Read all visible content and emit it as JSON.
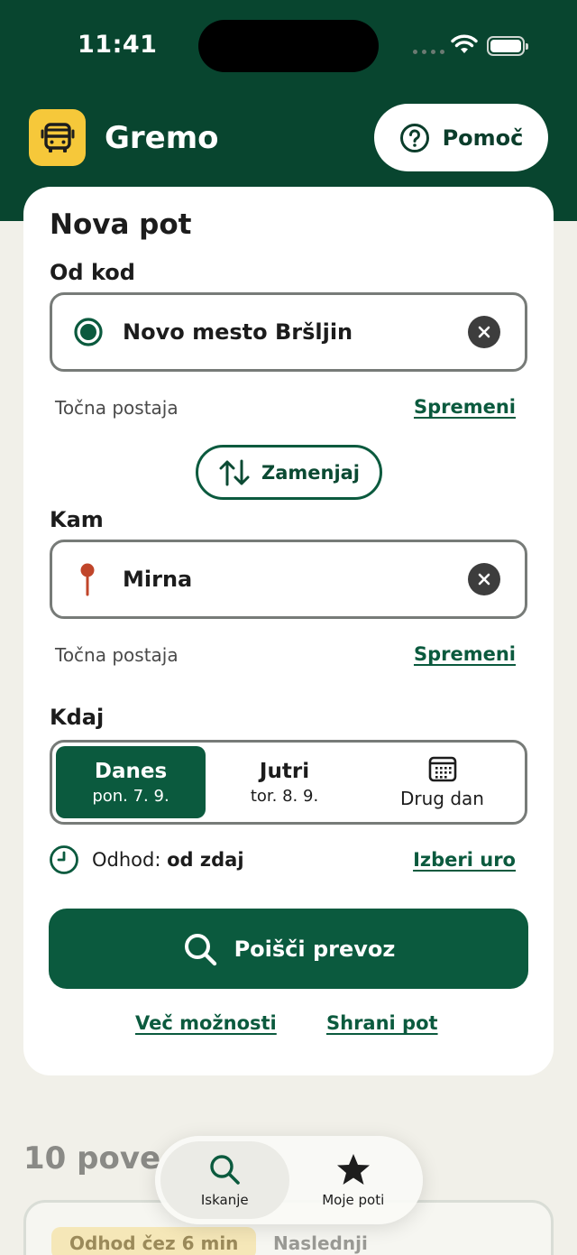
{
  "status_bar": {
    "time": "11:41"
  },
  "app": {
    "title": "Gremo",
    "help_label": "Pomoč"
  },
  "form": {
    "title": "Nova pot",
    "from": {
      "label": "Od kod",
      "value": "Novo mesto Bršljin",
      "hint": "Točna postaja",
      "change_label": "Spremeni"
    },
    "swap_label": "Zamenjaj",
    "to": {
      "label": "Kam",
      "value": "Mirna",
      "hint": "Točna postaja",
      "change_label": "Spremeni"
    },
    "when": {
      "label": "Kdaj",
      "options": [
        {
          "main": "Danes",
          "sub": "pon. 7. 9.",
          "selected": true
        },
        {
          "main": "Jutri",
          "sub": "tor. 8. 9.",
          "selected": false
        },
        {
          "main": "Drug dan",
          "sub": "",
          "selected": false
        }
      ]
    },
    "departure": {
      "prefix": "Odhod:",
      "value": "od zdaj",
      "change_label": "Izberi uro"
    },
    "search_label": "Poišči prevoz",
    "more_options_label": "Več možnosti",
    "save_route_label": "Shrani pot"
  },
  "results": {
    "title": "10 pove",
    "chips": [
      "Odhod čez 6 min",
      "Naslednji"
    ]
  },
  "tabbar": {
    "items": [
      {
        "label": "Iskanje",
        "icon": "search-icon",
        "active": true
      },
      {
        "label": "Moje poti",
        "icon": "star-icon",
        "active": false
      }
    ]
  },
  "colors": {
    "brand_dark": "#08452f",
    "brand": "#0b5a3e",
    "logo_yellow": "#f6c83a",
    "background": "#f1f0e9",
    "pin_red": "#c0452a"
  }
}
